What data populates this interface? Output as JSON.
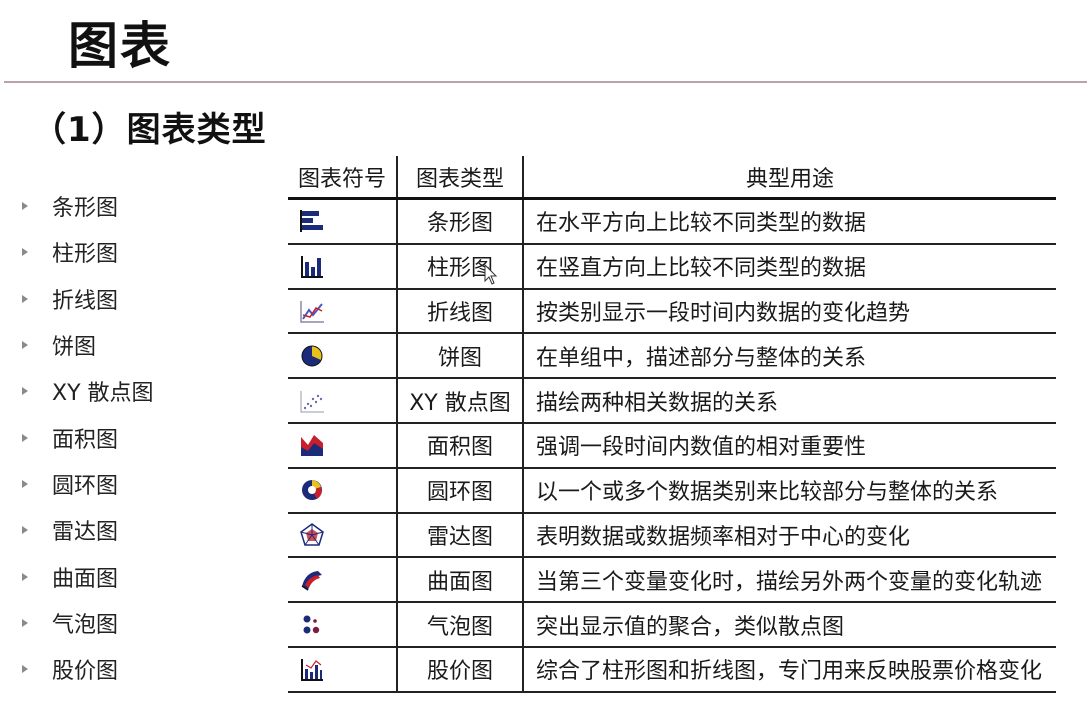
{
  "page": {
    "title": "图表",
    "subtitle": "（1）图表类型"
  },
  "bullets": [
    "条形图",
    "柱形图",
    "折线图",
    "饼图",
    "XY 散点图",
    "面积图",
    "圆环图",
    "雷达图",
    "曲面图",
    "气泡图",
    "股价图"
  ],
  "table": {
    "headers": [
      "图表符号",
      "图表类型",
      "典型用途"
    ],
    "rows": [
      {
        "icon": "bar-chart-icon",
        "type": "条形图",
        "use": "在水平方向上比较不同类型的数据"
      },
      {
        "icon": "column-chart-icon",
        "type": "柱形图",
        "use": "在竖直方向上比较不同类型的数据"
      },
      {
        "icon": "line-chart-icon",
        "type": "折线图",
        "use": "按类别显示一段时间内数据的变化趋势"
      },
      {
        "icon": "pie-chart-icon",
        "type": "饼图",
        "use": "在单组中，描述部分与整体的关系"
      },
      {
        "icon": "scatter-chart-icon",
        "type": "XY 散点图",
        "use": "描绘两种相关数据的关系"
      },
      {
        "icon": "area-chart-icon",
        "type": "面积图",
        "use": "强调一段时间内数值的相对重要性"
      },
      {
        "icon": "doughnut-chart-icon",
        "type": "圆环图",
        "use": "以一个或多个数据类别来比较部分与整体的关系"
      },
      {
        "icon": "radar-chart-icon",
        "type": "雷达图",
        "use": "表明数据或数据频率相对于中心的变化"
      },
      {
        "icon": "surface-chart-icon",
        "type": "曲面图",
        "use": "当第三个变量变化时，描绘另外两个变量的变化轨迹"
      },
      {
        "icon": "bubble-chart-icon",
        "type": "气泡图",
        "use": "突出显示值的聚合，类似散点图"
      },
      {
        "icon": "stock-chart-icon",
        "type": "股价图",
        "use": "综合了柱形图和折线图，专门用来反映股票价格变化"
      }
    ]
  },
  "colors": {
    "accent_navy": "#1c2a7a",
    "accent_red": "#c8202a",
    "accent_yellow": "#e8c21a",
    "rule": "#b9a3a7"
  }
}
